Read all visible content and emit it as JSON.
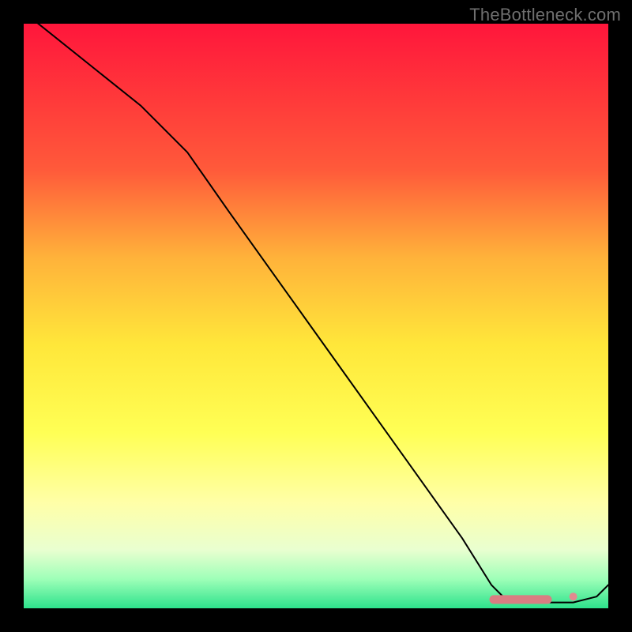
{
  "watermark": "TheBottleneck.com",
  "colors": {
    "background": "#000000",
    "watermark_text": "#6f6f6f",
    "curve": "#000000",
    "marker": "#d97d82",
    "gradient_top": "#ff163b",
    "gradient_bottom": "#2de28c"
  },
  "chart_data": {
    "type": "line",
    "title": "",
    "xlabel": "",
    "ylabel": "",
    "xlim": [
      0,
      100
    ],
    "ylim": [
      0,
      100
    ],
    "grid": false,
    "series": [
      {
        "name": "curve",
        "x": [
          0,
          10,
          20,
          28,
          35,
          45,
          55,
          65,
          75,
          80,
          82,
          86,
          90,
          94,
          98,
          100
        ],
        "values": [
          102,
          94,
          86,
          78,
          68,
          54,
          40,
          26,
          12,
          4,
          2,
          1,
          1,
          1,
          2,
          4
        ]
      }
    ],
    "markers": [
      {
        "shape": "pill",
        "x_start": 80,
        "x_end": 90,
        "y": 1.5
      },
      {
        "shape": "dot",
        "x": 94,
        "y": 2
      }
    ]
  }
}
